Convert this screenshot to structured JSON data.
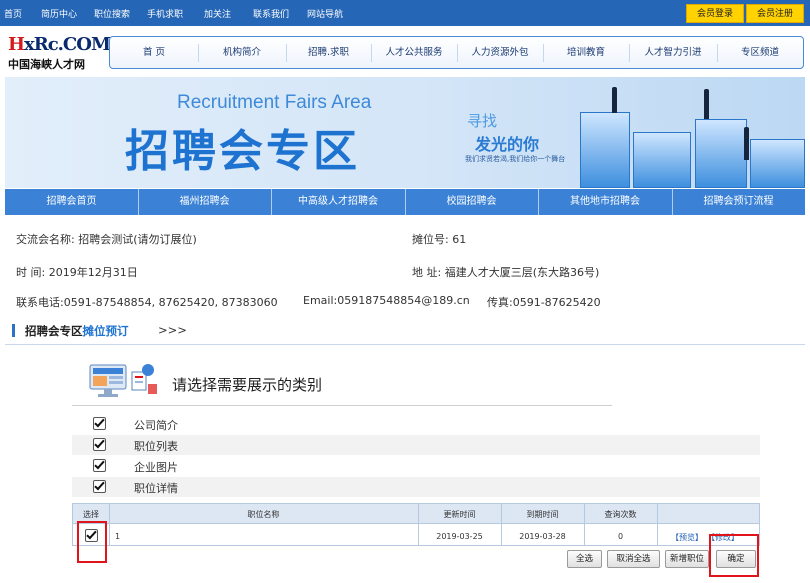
{
  "topbar": {
    "links": [
      "首页",
      "简历中心",
      "职位搜索",
      "手机求职",
      "加关注",
      "联系我们",
      "网站导航"
    ],
    "member_login": "会员登录",
    "member_register": "会员注册"
  },
  "logo": {
    "mark": "xRc.COM",
    "name": "中国海峡人才网"
  },
  "main_nav": [
    "首  页",
    "机构简介",
    "招聘.求职",
    "人才公共服务",
    "人力资源外包",
    "培训教育",
    "人才智力引进",
    "专区频道"
  ],
  "banner": {
    "en_title": "Recruitment Fairs Area",
    "cn_title": "招聘会专区",
    "slogan_1": "寻找",
    "slogan_2": "发光的你",
    "slogan_3": "我们求贤若渴,我们给你一个舞台"
  },
  "sub_nav": [
    "招聘会首页",
    "福州招聘会",
    "中高级人才招聘会",
    "校园招聘会",
    "其他地市招聘会",
    "招聘会预订流程"
  ],
  "fair_info": {
    "name_label": "交流会名称:",
    "name_value": "招聘会测试(请勿订展位)",
    "booth_label": "摊位号:",
    "booth_value": "61",
    "time_label": "时  间:",
    "time_value": "2019年12月31日",
    "address_label": "地  址:",
    "address_value": "福建人才大厦三层(东大路36号)",
    "phone_label": "联系电话:",
    "phone_value": "0591-87548854, 87625420, 87383060",
    "email_label": "Email:",
    "email_value": "059187548854@189.cn",
    "fax_label": "传真:",
    "fax_value": "0591-87625420"
  },
  "section": {
    "title_prefix": "招聘会专区",
    "title_highlight": "摊位预订",
    "arrows": ">>>"
  },
  "chooser": {
    "title": "请选择需要展示的类别",
    "options": [
      {
        "label": "公司简介",
        "checked": true
      },
      {
        "label": "职位列表",
        "checked": true
      },
      {
        "label": "企业图片",
        "checked": true
      },
      {
        "label": "职位详情",
        "checked": true
      }
    ]
  },
  "table": {
    "headers": [
      "选择",
      "职位名称",
      "更新时间",
      "到期时间",
      "查询次数"
    ],
    "rows": [
      {
        "checked": true,
        "name": "1",
        "updated": "2019-03-25",
        "expires": "2019-03-28",
        "views": "0",
        "preview": "【预览】",
        "edit": "【修改】"
      }
    ]
  },
  "buttons": {
    "select_all": "全选",
    "deselect_all": "取消全选",
    "add_job": "新增职位",
    "confirm": "确定"
  },
  "colors": {
    "topbar": "#2566b6",
    "accent_blue": "#3b82d6",
    "member_button": "#ffd200",
    "highlight_box": "#e0141a"
  }
}
